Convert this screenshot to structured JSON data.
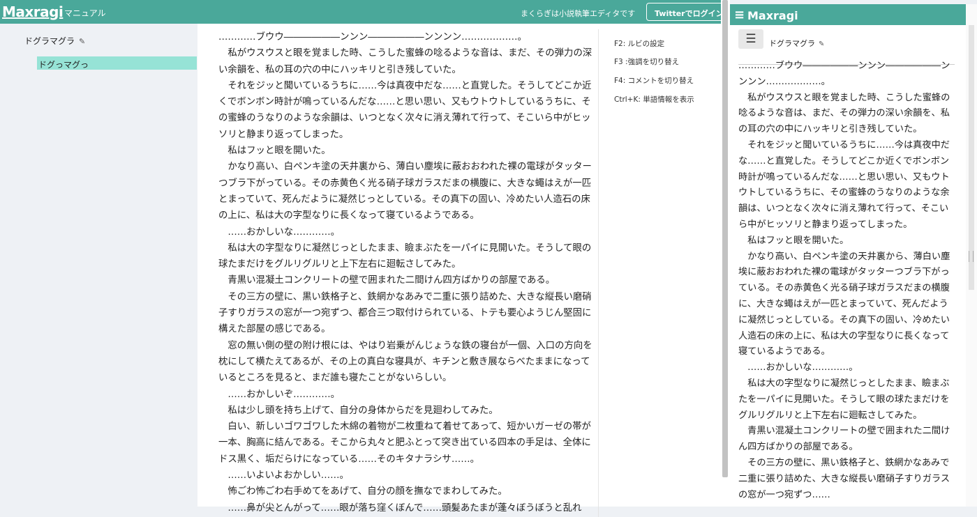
{
  "header": {
    "logo": "Maxragi",
    "manual_link": "マニュアル",
    "tagline": "まくらぎは小説執筆エディタです",
    "login_button": "Twitterでログイン"
  },
  "sidebar": {
    "project_title": "ドグラマグラ",
    "edit_icon": "pencil-icon",
    "items": [
      {
        "label": "ドグっマグっ",
        "selected": true
      }
    ]
  },
  "editor": {
    "paragraphs": [
      "…………ブウウ――――――ンンン――――――ンンンン………………。",
      "　私がウスウスと眼を覚ました時、こうした蜜蜂の唸るような音は、まだ、その弾力の深い余韻を、私の耳の穴の中にハッキリと引き残していた。",
      "　それをジッと聞いているうちに……今は真夜中だな……と直覚した。そうしてどこか近くでボンボン時計が鳴っているんだな……と思い思い、又もウトウトしているうちに、その蜜蜂のうなりのような余韻は、いつとなく次々に消え薄れて行って、そこいら中がヒッソリと静まり返ってしまった。",
      "　私はフッと眼を開いた。",
      "　かなり高い、白ペンキ塗の天井裏から、薄白い塵埃に蔽おおわれた裸の電球がタッターつブラ下がっている。その赤黄色く光る硝子球ガラスだまの横腹に、大きな蠅はえが一匹とまっていて、死んだように凝然じっとしている。その真下の固い、冷めたい人造石の床の上に、私は大の字型なりに長くなって寝ているようである。",
      "　……おかしいな…………。",
      "　私は大の字型なりに凝然じっとしたまま、瞼まぶたを一パイに見開いた。そうして眼の球たまだけをグルリグルリと上下左右に廻転さしてみた。",
      "　青黒い混凝土コンクリートの壁で囲まれた二間けん四方ばかりの部屋である。",
      "　その三方の壁に、黒い鉄格子と、鉄網かなあみで二重に張り詰めた、大きな縦長い磨硝子すりガラスの窓が一つ宛ずつ、都合三つ取付けられている、トテも要心ようじん堅固に構えた部屋の感じである。",
      "　窓の無い側の壁の附け根には、やはり岩乗がんじょうな鉄の寝台が一個、入口の方向を枕にして横たえてあるが、その上の真白な寝具が、キチンと敷き展ならべたままになっているところを見ると、まだ誰も寝たことがないらしい。",
      "　……おかしいぞ…………。",
      "　私は少し頭を持ち上げて、自分の身体からだを見廻わしてみた。",
      "　白い、新しいゴワゴワした木綿の着物が二枚重ねて着せてあって、短かいガーゼの帯が一本、胸高に結んである。そこから丸々と肥ふとって突き出ている四本の手足は、全体にドス黒く、垢だらけになっている……そのキタナラシサ……。",
      "　……いよいよおかしい……。",
      "　怖ごわ怖ごわ右手めてをあげて、自分の顔を撫なでまわしてみた。",
      "　……鼻が尖とんがって……眼が落ち窪くぼんで……頭髪あたまが蓬々ぼうぼうと乱れて……"
    ]
  },
  "shortcuts": [
    "F2: ルビの設定",
    "F3 :強調を切り替え",
    "F4: コメントを切り替え",
    "Ctrl+K: 単語情報を表示"
  ],
  "preview": {
    "brand": "Maxragi",
    "menu_icon": "hamburger-icon",
    "title": "ドグラマグラ",
    "paragraphs": [
      "…………ブウウ――――――ンンン――――――ンンンン………………。",
      "　私がウスウスと眼を覚ました時、こうした蜜蜂の唸るような音は、まだ、その弾力の深い余韻を、私の耳の穴の中にハッキリと引き残していた。",
      "　それをジッと聞いているうちに……今は真夜中だな……と直覚した。そうしてどこか近くでボンボン時計が鳴っているんだな……と思い思い、又もウトウトしているうちに、その蜜蜂のうなりのような余韻は、いつとなく次々に消え薄れて行って、そこいら中がヒッソリと静まり返ってしまった。",
      "　私はフッと眼を開いた。",
      "　かなり高い、白ペンキ塗の天井裏から、薄白い塵埃に蔽おおわれた裸の電球がタッターつブラ下がっている。その赤黄色く光る硝子球ガラスだまの横腹に、大きな蠅はえが一匹とまっていて、死んだように凝然じっとしている。その真下の固い、冷めたい人造石の床の上に、私は大の字型なりに長くなって寝ているようである。",
      "　……おかしいな…………。",
      "　私は大の字型なりに凝然じっとしたまま、瞼まぶたを一パイに見開いた。そうして眼の球たまだけをグルリグルリと上下左右に廻転さしてみた。",
      "　青黒い混凝土コンクリートの壁で囲まれた二間けん四方ばかりの部屋である。",
      "　その三方の壁に、黒い鉄格子と、鉄網かなあみで二重に張り詰めた、大きな縦長い磨硝子すりガラスの窓が一つ宛ずつ……"
    ]
  },
  "colors": {
    "accent": "#4aa89a",
    "selected": "#96e3d6",
    "background": "#eef1f5"
  }
}
